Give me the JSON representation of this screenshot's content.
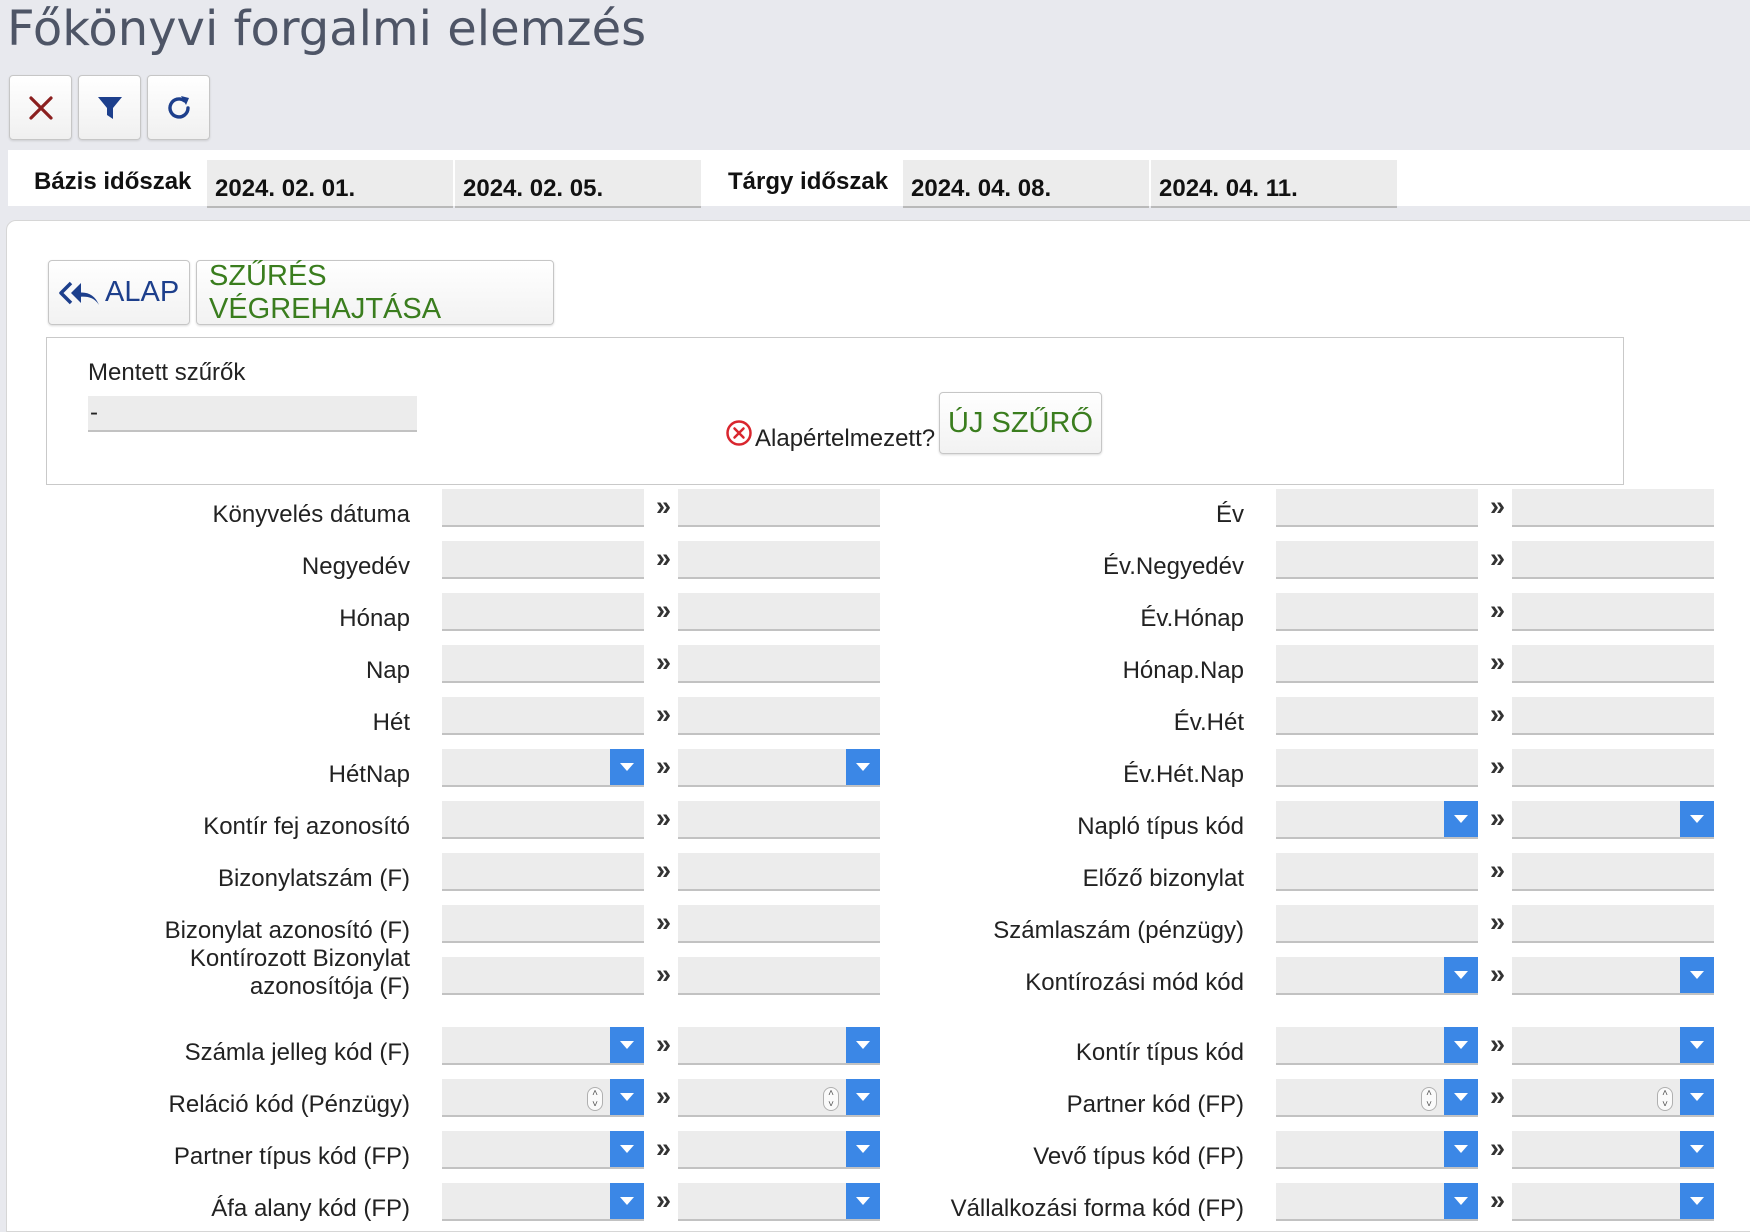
{
  "page": {
    "title": "Főkönyvi forgalmi elemzés"
  },
  "toolbar": {
    "icons": [
      "close-icon",
      "filter-icon",
      "refresh-icon"
    ]
  },
  "periods": {
    "base_label": "Bázis időszak",
    "base_from": "2024. 02. 01.",
    "base_to": "2024. 02. 05.",
    "target_label": "Tárgy időszak",
    "target_from": "2024. 04. 08.",
    "target_to": "2024. 04. 11."
  },
  "actions": {
    "base_label": "ALAP",
    "apply_label": "SZŰRÉS VÉGREHAJTÁSA"
  },
  "saved_filters": {
    "label": "Mentett szűrők",
    "value": "-",
    "default_label": "Alapértelmezett?",
    "new_filter_label": "ÚJ SZŰRŐ"
  },
  "range_separator": "»",
  "colors": {
    "accent_blue": "#3b87e6",
    "green": "#3a7d1e",
    "navy": "#1d3f8c",
    "close_red": "#8b1f1f"
  },
  "filters_left": [
    {
      "label": "Könyvelés dátuma",
      "type": "text"
    },
    {
      "label": "Negyedév",
      "type": "text"
    },
    {
      "label": "Hónap",
      "type": "text"
    },
    {
      "label": "Nap",
      "type": "text"
    },
    {
      "label": "Hét",
      "type": "text"
    },
    {
      "label": "HétNap",
      "type": "select"
    },
    {
      "label": "Kontír fej azonosító",
      "type": "text"
    },
    {
      "label": "Bizonylatszám (F)",
      "type": "text"
    },
    {
      "label": "Bizonylat azonosító (F)",
      "type": "text"
    },
    {
      "label": "Kontírozott Bizonylat azonosítója (F)",
      "type": "text"
    },
    {
      "label": "Számla jelleg kód (F)",
      "type": "select"
    },
    {
      "label": "Reláció kód (Pénzügy)",
      "type": "spin-select"
    },
    {
      "label": "Partner típus kód (FP)",
      "type": "select"
    },
    {
      "label": "Áfa alany kód (FP)",
      "type": "select"
    }
  ],
  "filters_right": [
    {
      "label": "Év",
      "type": "text"
    },
    {
      "label": "Év.Negyedév",
      "type": "text"
    },
    {
      "label": "Év.Hónap",
      "type": "text"
    },
    {
      "label": "Hónap.Nap",
      "type": "text"
    },
    {
      "label": "Év.Hét",
      "type": "text"
    },
    {
      "label": "Év.Hét.Nap",
      "type": "text"
    },
    {
      "label": "Napló típus kód",
      "type": "select"
    },
    {
      "label": "Előző bizonylat",
      "type": "text"
    },
    {
      "label": "Számlaszám (pénzügy)",
      "type": "text"
    },
    {
      "label": "Kontírozási mód kód",
      "type": "select"
    },
    {
      "label": "Kontír típus kód",
      "type": "select"
    },
    {
      "label": "Partner kód (FP)",
      "type": "spin-select"
    },
    {
      "label": "Vevő típus kód (FP)",
      "type": "select"
    },
    {
      "label": "Vállalkozási forma kód (FP)",
      "type": "select"
    }
  ]
}
